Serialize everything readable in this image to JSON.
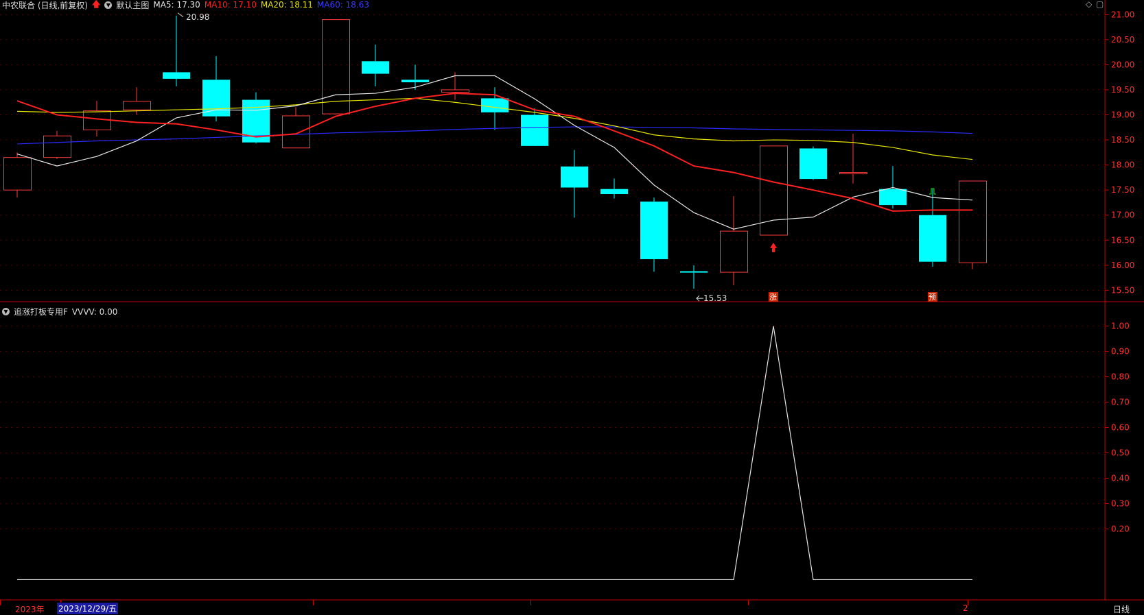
{
  "header": {
    "stock": "中农联合 (日线,前复权)",
    "template": "默认主图",
    "ma5_label": "MA5:",
    "ma5_value": "17.30",
    "ma10_label": "MA10:",
    "ma10_value": "17.10",
    "ma20_label": "MA20:",
    "ma20_value": "18.11",
    "ma60_label": "MA60:",
    "ma60_value": "18.63"
  },
  "indicator": {
    "name": "追涨打板专用F",
    "value_text": "VVVV: 0.00"
  },
  "xaxis": {
    "year": "2023年",
    "date": "2023/12/29/五",
    "right_tick": "2",
    "period": "日线"
  },
  "colors": {
    "up": "#ff3b3b",
    "down": "#00ffff",
    "ma5": "#e6e6e6",
    "ma10": "#ff2020",
    "ma20": "#e6e600",
    "ma60": "#2b2bff",
    "grid": "#5a0000",
    "axis": "#c80000"
  },
  "chart_data": [
    {
      "type": "candlestick",
      "ylim": [
        15.3,
        21.1
      ],
      "yticks": [
        "21.00",
        "20.50",
        "20.00",
        "19.50",
        "19.00",
        "18.50",
        "18.00",
        "17.50",
        "17.00",
        "16.50",
        "16.00",
        "15.50"
      ],
      "candles": [
        {
          "o": 17.5,
          "h": 18.25,
          "l": 17.35,
          "c": 18.15
        },
        {
          "o": 18.15,
          "h": 18.68,
          "l": 18.12,
          "c": 18.58
        },
        {
          "o": 18.7,
          "h": 19.28,
          "l": 18.57,
          "c": 19.08
        },
        {
          "o": 19.1,
          "h": 19.55,
          "l": 19.0,
          "c": 19.27
        },
        {
          "o": 19.85,
          "h": 20.98,
          "l": 19.57,
          "c": 19.72
        },
        {
          "o": 19.7,
          "h": 20.17,
          "l": 18.87,
          "c": 18.97
        },
        {
          "o": 19.3,
          "h": 19.45,
          "l": 18.43,
          "c": 18.45
        },
        {
          "o": 18.34,
          "h": 19.15,
          "l": 18.34,
          "c": 18.98
        },
        {
          "o": 19.02,
          "h": 20.9,
          "l": 19.02,
          "c": 20.9
        },
        {
          "o": 20.07,
          "h": 20.4,
          "l": 19.57,
          "c": 19.82
        },
        {
          "o": 19.7,
          "h": 20.0,
          "l": 19.5,
          "c": 19.65
        },
        {
          "o": 19.45,
          "h": 19.85,
          "l": 19.3,
          "c": 19.5
        },
        {
          "o": 19.33,
          "h": 19.55,
          "l": 18.7,
          "c": 19.05
        },
        {
          "o": 19.0,
          "h": 19.13,
          "l": 18.4,
          "c": 18.38
        },
        {
          "o": 17.97,
          "h": 18.3,
          "l": 16.95,
          "c": 17.55
        },
        {
          "o": 17.52,
          "h": 17.73,
          "l": 17.33,
          "c": 17.42
        },
        {
          "o": 17.27,
          "h": 17.35,
          "l": 15.87,
          "c": 16.12
        },
        {
          "o": 15.88,
          "h": 16.0,
          "l": 15.53,
          "c": 15.87
        },
        {
          "o": 15.86,
          "h": 17.38,
          "l": 15.6,
          "c": 16.68
        },
        {
          "o": 16.6,
          "h": 18.38,
          "l": 16.6,
          "c": 18.38
        },
        {
          "o": 18.33,
          "h": 18.37,
          "l": 17.7,
          "c": 17.72
        },
        {
          "o": 17.85,
          "h": 18.62,
          "l": 17.63,
          "c": 17.85
        },
        {
          "o": 17.52,
          "h": 17.98,
          "l": 17.13,
          "c": 17.2
        },
        {
          "o": 17.0,
          "h": 17.52,
          "l": 15.97,
          "c": 16.07
        },
        {
          "o": 16.05,
          "h": 17.68,
          "l": 15.92,
          "c": 17.68
        }
      ],
      "ma5": [
        18.22,
        17.98,
        18.17,
        18.48,
        18.94,
        19.1,
        19.09,
        19.18,
        19.4,
        19.43,
        19.55,
        19.78,
        19.78,
        19.32,
        18.79,
        18.35,
        17.6,
        17.05,
        16.72,
        16.9,
        16.96,
        17.36,
        17.55,
        17.35,
        17.3
      ],
      "ma10": [
        19.28,
        19.0,
        18.92,
        18.85,
        18.82,
        18.7,
        18.56,
        18.62,
        18.97,
        19.17,
        19.33,
        19.43,
        19.4,
        19.1,
        18.97,
        18.68,
        18.38,
        17.98,
        17.85,
        17.66,
        17.5,
        17.33,
        17.08,
        17.1,
        17.1
      ],
      "ma20": [
        19.07,
        19.05,
        19.06,
        19.08,
        19.1,
        19.12,
        19.15,
        19.2,
        19.27,
        19.3,
        19.33,
        19.25,
        19.15,
        19.05,
        18.93,
        18.78,
        18.6,
        18.52,
        18.48,
        18.5,
        18.49,
        18.45,
        18.35,
        18.2,
        18.11
      ],
      "ma60": [
        18.42,
        18.45,
        18.48,
        18.5,
        18.52,
        18.55,
        18.58,
        18.61,
        18.64,
        18.66,
        18.68,
        18.71,
        18.73,
        18.75,
        18.76,
        18.76,
        18.75,
        18.74,
        18.72,
        18.71,
        18.7,
        18.69,
        18.68,
        18.66,
        18.63
      ],
      "annotations": [
        {
          "index": 4,
          "value": 20.98,
          "text": "20.98"
        },
        {
          "index": 17,
          "value": 15.53,
          "text": "15.53"
        }
      ],
      "signals": [
        {
          "index": 19,
          "text": "涨"
        },
        {
          "index": 23,
          "text": "预"
        }
      ]
    },
    {
      "type": "line",
      "series": [
        {
          "name": "VVVV",
          "values": [
            0,
            0,
            0,
            0,
            0,
            0,
            0,
            0,
            0,
            0,
            0,
            0,
            0,
            0,
            0,
            0,
            0,
            0,
            0,
            1,
            0,
            0,
            0,
            0,
            0
          ]
        }
      ],
      "ylim": [
        -0.08,
        1.08
      ],
      "yticks": [
        "1.00",
        "0.90",
        "0.80",
        "0.70",
        "0.60",
        "0.50",
        "0.40",
        "0.30",
        "0.20"
      ]
    }
  ]
}
